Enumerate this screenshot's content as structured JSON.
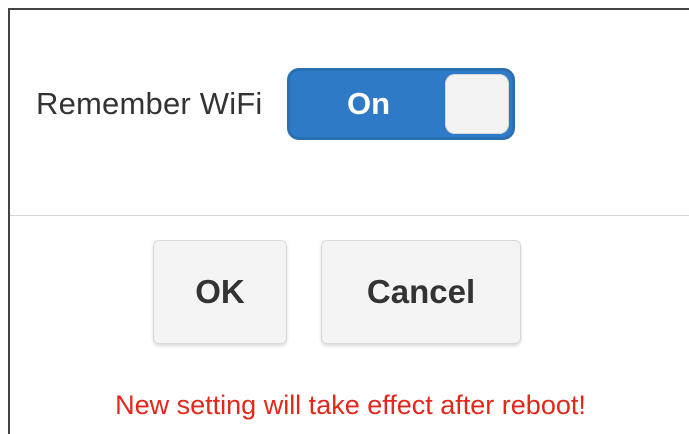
{
  "setting": {
    "label": "Remember WiFi",
    "toggle_text": "On",
    "enabled": true
  },
  "buttons": {
    "ok_label": "OK",
    "cancel_label": "Cancel"
  },
  "notice": "New setting will take effect after reboot!",
  "colors": {
    "toggle_on": "#2f7ac6",
    "notice_text": "#e3271c",
    "button_bg": "#f4f4f4"
  }
}
